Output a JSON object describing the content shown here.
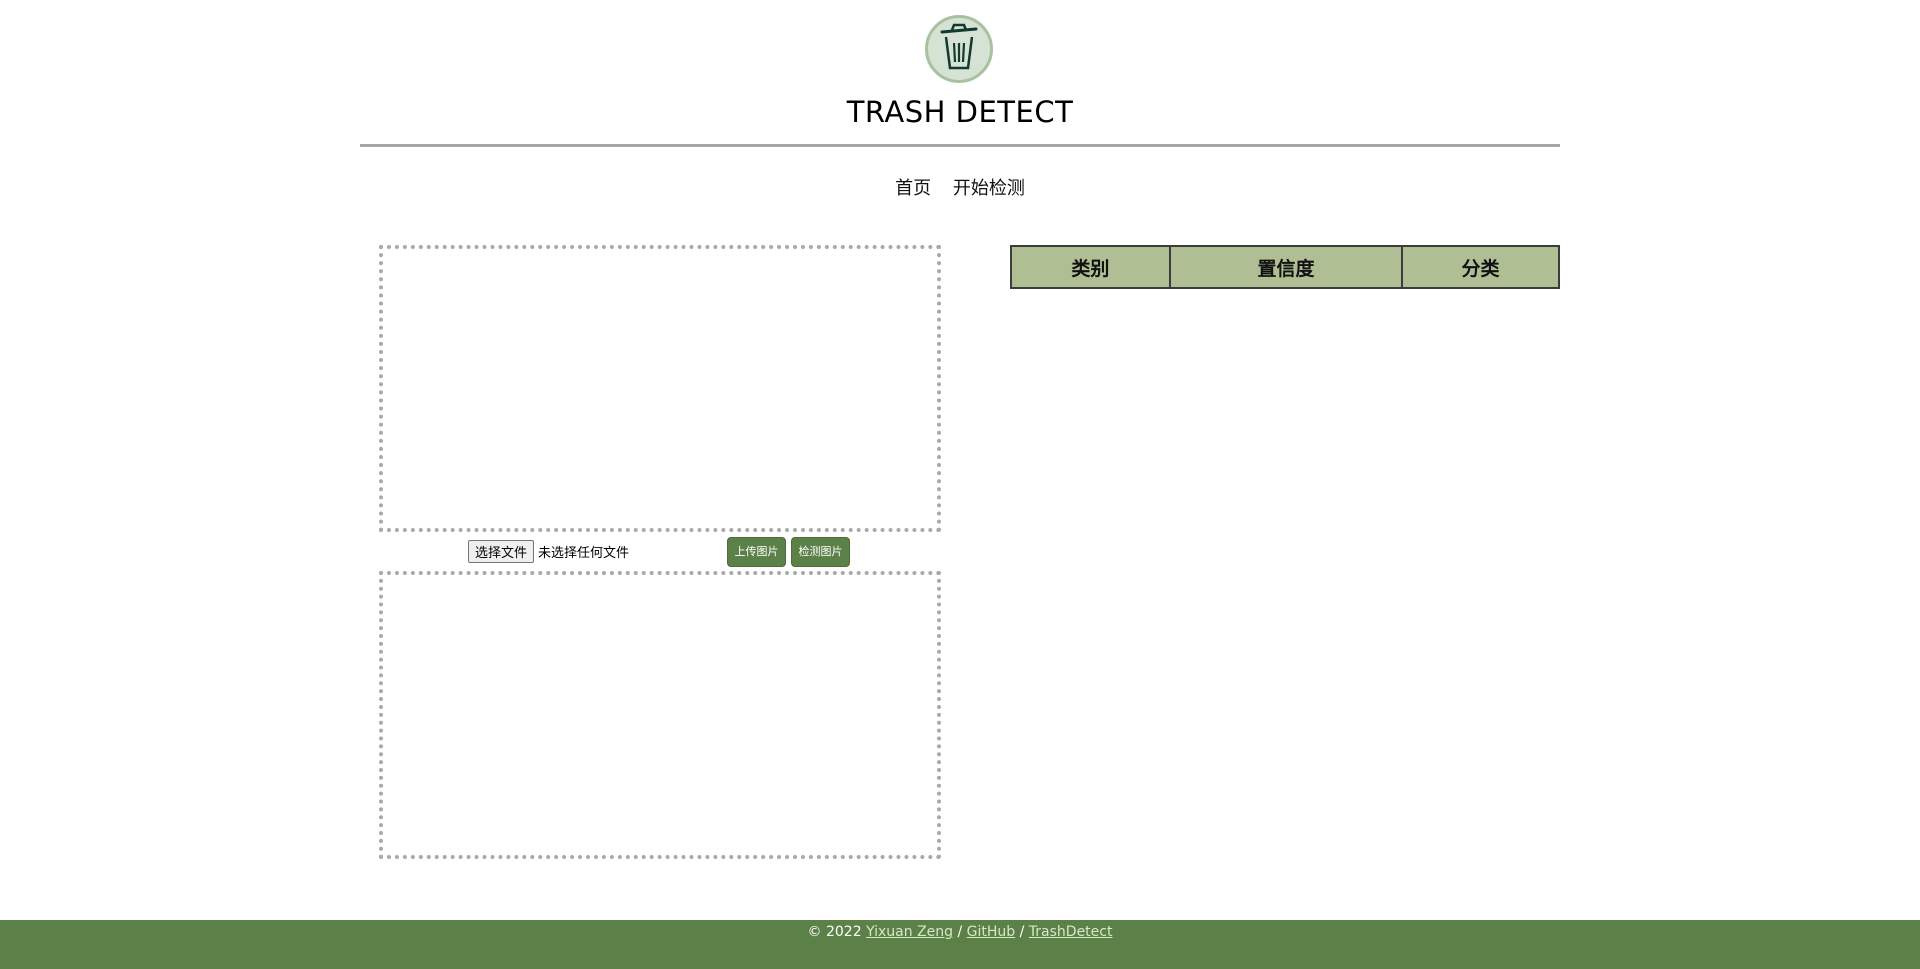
{
  "header": {
    "logo_icon": "trash-can-icon",
    "title": "TRASH DETECT"
  },
  "nav": {
    "items": [
      "首页",
      "开始检测"
    ]
  },
  "upload": {
    "choose_file_label": "选择文件",
    "file_status": "未选择任何文件",
    "upload_button": "上传图片",
    "detect_button": "检测图片"
  },
  "results": {
    "columns": [
      "类别",
      "置信度",
      "分类"
    ],
    "rows": []
  },
  "footer": {
    "copyright": "© 2022",
    "author": "Yixuan Zeng",
    "sep1": "/",
    "github": "GitHub",
    "sep2": "/",
    "repo": "TrashDetect"
  },
  "colors": {
    "accent": "#5b8148",
    "table_header": "#b0bf93",
    "logo_bg": "#d6e2d3"
  }
}
